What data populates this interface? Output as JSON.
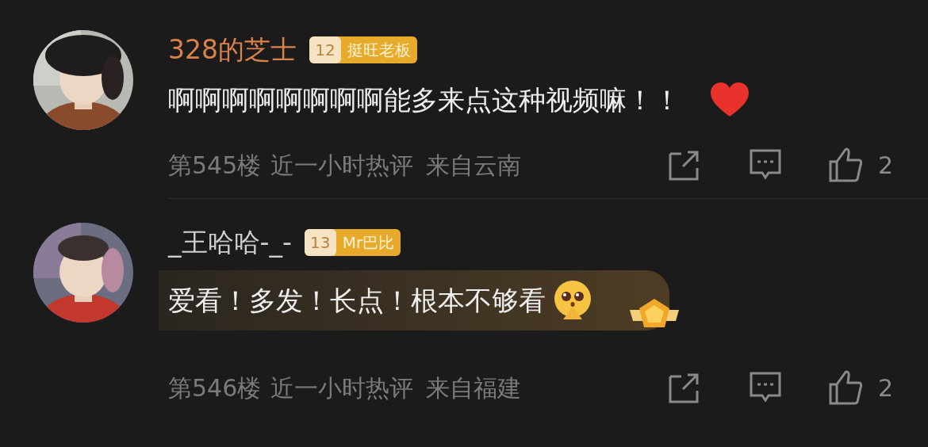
{
  "comments": [
    {
      "name": "328的芝士",
      "vip": true,
      "badge": {
        "level": "12",
        "title": "挺旺老板"
      },
      "text": "啊啊啊啊啊啊啊啊能多来点这种视频嘛！！",
      "emoji": {
        "kind": "heart"
      },
      "highlighted": false,
      "floor": "第545楼",
      "tag": "近一小时热评",
      "location": "来自云南",
      "likes": "2"
    },
    {
      "name": "_王哈哈-_-",
      "vip": false,
      "badge": {
        "level": "13",
        "title": "Mr巴比"
      },
      "text": "爱看！多发！长点！根本不够看",
      "emoji": {
        "kind": "pleading"
      },
      "highlighted": true,
      "floor": "第546楼",
      "tag": "近一小时热评",
      "location": "来自福建",
      "likes": "2"
    }
  ]
}
